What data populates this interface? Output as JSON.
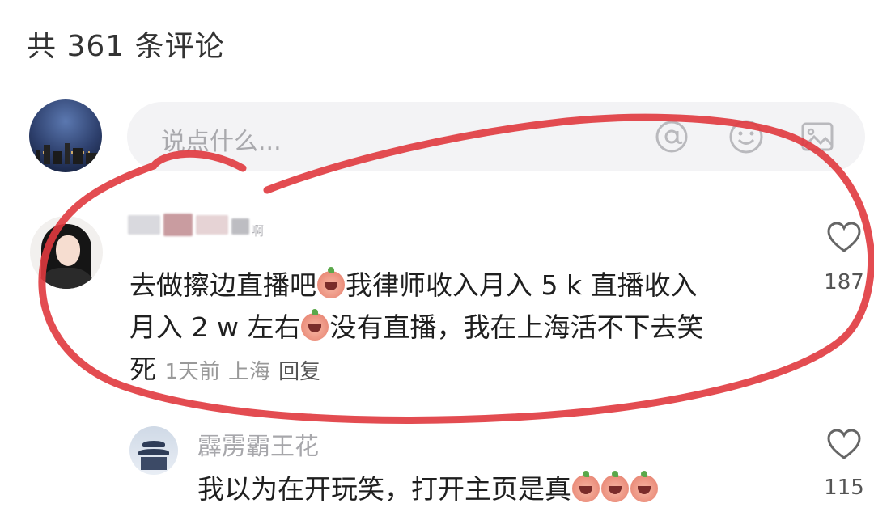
{
  "header": {
    "comment_count_label": "共 361 条评论"
  },
  "input": {
    "placeholder": "说点什么...",
    "icons": [
      "at-icon",
      "emoji-icon",
      "image-icon"
    ]
  },
  "comments": [
    {
      "name_partial": "啊",
      "text_line1": "去做擦边直播吧",
      "text_line1b": "我律师收入月入 5 k 直播收入",
      "text_line2a": "月入 2 w 左右",
      "text_line2b": "没有直播，我在上海活不下去笑",
      "text_line3": "死",
      "time": "1天前",
      "location": "上海",
      "reply_label": "回复",
      "likes": "187"
    }
  ],
  "reply": {
    "name": "霹雳霸王花",
    "text": "我以为在开玩笑，打开主页是真",
    "likes": "115"
  },
  "colors": {
    "annotation": "#e0393e",
    "placeholder": "#a9a9ad",
    "meta": "#999999"
  }
}
